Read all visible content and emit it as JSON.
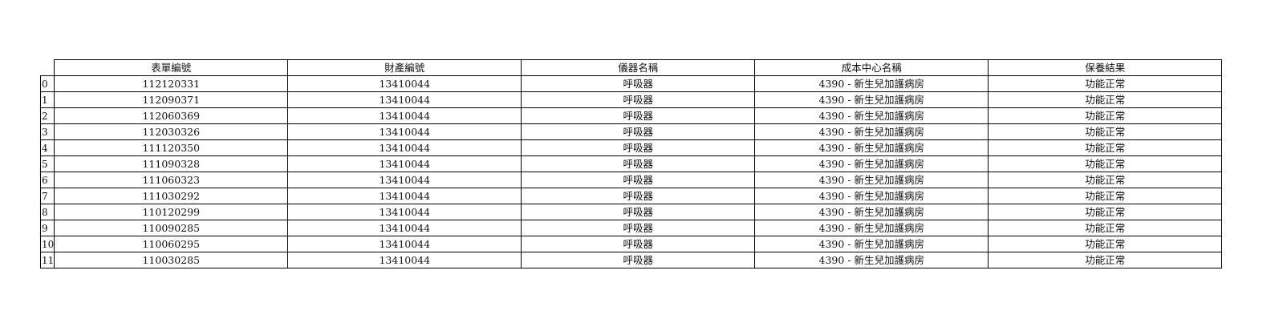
{
  "table": {
    "columns": [
      "表單編號",
      "財產編號",
      "儀器名稱",
      "成本中心名稱",
      "保養結果"
    ],
    "rows": [
      {
        "index": "0",
        "form_no": "112120331",
        "asset_no": "13410044",
        "instrument": "呼吸器",
        "cost_center": "4390  -  新生兒加護病房",
        "result": "功能正常"
      },
      {
        "index": "1",
        "form_no": "112090371",
        "asset_no": "13410044",
        "instrument": "呼吸器",
        "cost_center": "4390  -  新生兒加護病房",
        "result": "功能正常"
      },
      {
        "index": "2",
        "form_no": "112060369",
        "asset_no": "13410044",
        "instrument": "呼吸器",
        "cost_center": "4390  -  新生兒加護病房",
        "result": "功能正常"
      },
      {
        "index": "3",
        "form_no": "112030326",
        "asset_no": "13410044",
        "instrument": "呼吸器",
        "cost_center": "4390  -  新生兒加護病房",
        "result": "功能正常"
      },
      {
        "index": "4",
        "form_no": "111120350",
        "asset_no": "13410044",
        "instrument": "呼吸器",
        "cost_center": "4390  -  新生兒加護病房",
        "result": "功能正常"
      },
      {
        "index": "5",
        "form_no": "111090328",
        "asset_no": "13410044",
        "instrument": "呼吸器",
        "cost_center": "4390  -  新生兒加護病房",
        "result": "功能正常"
      },
      {
        "index": "6",
        "form_no": "111060323",
        "asset_no": "13410044",
        "instrument": "呼吸器",
        "cost_center": "4390  -  新生兒加護病房",
        "result": "功能正常"
      },
      {
        "index": "7",
        "form_no": "111030292",
        "asset_no": "13410044",
        "instrument": "呼吸器",
        "cost_center": "4390  -  新生兒加護病房",
        "result": "功能正常"
      },
      {
        "index": "8",
        "form_no": "110120299",
        "asset_no": "13410044",
        "instrument": "呼吸器",
        "cost_center": "4390  -  新生兒加護病房",
        "result": "功能正常"
      },
      {
        "index": "9",
        "form_no": "110090285",
        "asset_no": "13410044",
        "instrument": "呼吸器",
        "cost_center": "4390  -  新生兒加護病房",
        "result": "功能正常"
      },
      {
        "index": "10",
        "form_no": "110060295",
        "asset_no": "13410044",
        "instrument": "呼吸器",
        "cost_center": "4390  -  新生兒加護病房",
        "result": "功能正常"
      },
      {
        "index": "11",
        "form_no": "110030285",
        "asset_no": "13410044",
        "instrument": "呼吸器",
        "cost_center": "4390  -  新生兒加護病房",
        "result": "功能正常"
      }
    ]
  }
}
